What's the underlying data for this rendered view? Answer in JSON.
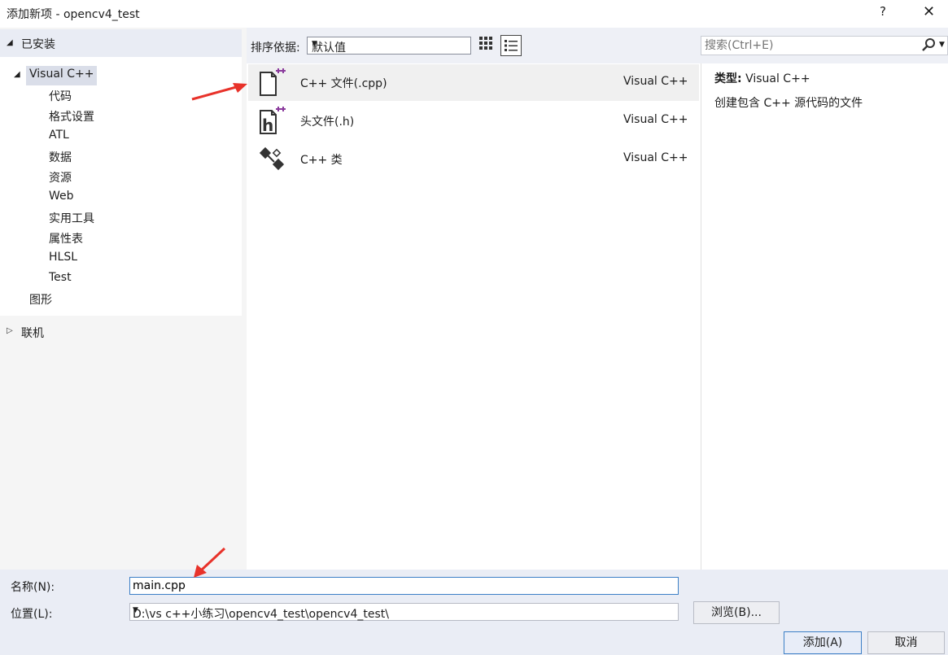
{
  "window": {
    "title": "添加新项 - opencv4_test",
    "help_label": "?",
    "close_label": "✕"
  },
  "tree": {
    "installed_label": "已安装",
    "root_label": "Visual C++",
    "children": [
      "代码",
      "格式设置",
      "ATL",
      "数据",
      "资源",
      "Web",
      "实用工具",
      "属性表",
      "HLSL",
      "Test"
    ],
    "graphics_label": "图形",
    "online_label": "联机"
  },
  "toolbar": {
    "sort_label": "排序依据:",
    "sort_value": "默认值",
    "search_placeholder": "搜索(Ctrl+E)"
  },
  "templates": [
    {
      "name": "C++ 文件(.cpp)",
      "language": "Visual C++",
      "icon": "cpp-file-icon"
    },
    {
      "name": "头文件(.h)",
      "language": "Visual C++",
      "icon": "header-file-icon"
    },
    {
      "name": "C++ 类",
      "language": "Visual C++",
      "icon": "cpp-class-icon"
    }
  ],
  "details": {
    "type_label": "类型:",
    "type_value": "Visual C++",
    "description": "创建包含 C++ 源代码的文件"
  },
  "form": {
    "name_label": "名称(N):",
    "name_value": "main.cpp",
    "location_label": "位置(L):",
    "location_value": "D:\\vs c++小练习\\opencv4_test\\opencv4_test\\",
    "browse_label": "浏览(B)...",
    "add_label": "添加(A)",
    "cancel_label": "取消"
  },
  "colors": {
    "accent": "#3c7fc6",
    "selection": "#dadee9",
    "annotation_arrow": "#e8322a",
    "icon_plus": "#8a3a9c"
  }
}
